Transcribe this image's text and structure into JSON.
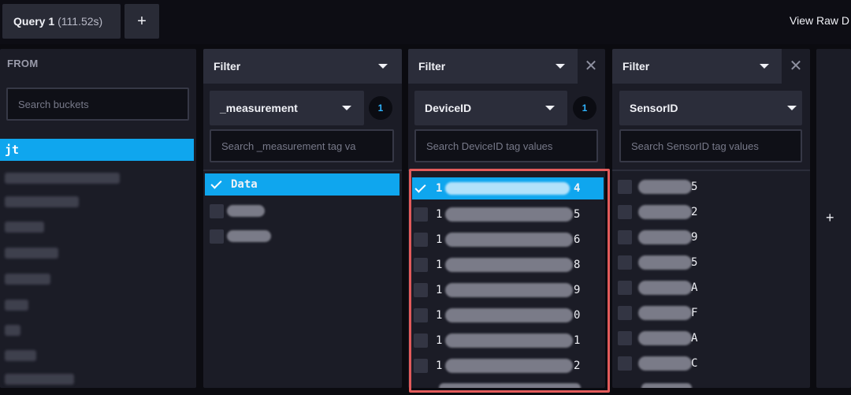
{
  "header": {
    "query_tab_label": "Query 1",
    "query_tab_time": "(111.52s)",
    "add_tab_label": "+",
    "view_raw_label": "View Raw D"
  },
  "from_panel": {
    "title": "FROM",
    "search_placeholder": "Search buckets",
    "buckets": [
      {
        "label": "jt",
        "selected": true
      },
      {
        "label": "",
        "selected": false
      },
      {
        "label": "",
        "selected": false
      },
      {
        "label": "",
        "selected": false
      },
      {
        "label": "",
        "selected": false
      },
      {
        "label": "",
        "selected": false
      },
      {
        "label": "",
        "selected": false
      },
      {
        "label": "",
        "selected": false
      },
      {
        "label": "",
        "selected": false
      },
      {
        "label": "",
        "selected": false
      }
    ]
  },
  "filter_1": {
    "header_label": "Filter",
    "tag_key": "_measurement",
    "selected_count": "1",
    "search_placeholder": "Search _measurement tag va",
    "values": [
      {
        "label": "Data",
        "checked": true
      },
      {
        "label": "",
        "checked": false
      },
      {
        "label": "",
        "checked": false
      }
    ]
  },
  "filter_2": {
    "header_label": "Filter",
    "tag_key": "DeviceID",
    "selected_count": "1",
    "search_placeholder": "Search DeviceID tag values",
    "values": [
      {
        "prefix": "1",
        "suffix": "4",
        "checked": true
      },
      {
        "prefix": "1",
        "suffix": "5",
        "checked": false
      },
      {
        "prefix": "1",
        "suffix": "6",
        "checked": false
      },
      {
        "prefix": "1",
        "suffix": "8",
        "checked": false
      },
      {
        "prefix": "1",
        "suffix": "9",
        "checked": false
      },
      {
        "prefix": "1",
        "suffix": "0",
        "checked": false
      },
      {
        "prefix": "1",
        "suffix": "1",
        "checked": false
      },
      {
        "prefix": "1",
        "suffix": "2",
        "checked": false
      }
    ],
    "highlight_color": "#e25b5b"
  },
  "filter_3": {
    "header_label": "Filter",
    "tag_key": "SensorID",
    "search_placeholder": "Search SensorID tag values",
    "values": [
      {
        "suffix": "5"
      },
      {
        "suffix": "2"
      },
      {
        "suffix": "9"
      },
      {
        "suffix": "5"
      },
      {
        "suffix": "A"
      },
      {
        "suffix": "F"
      },
      {
        "suffix": "A"
      },
      {
        "suffix": "C"
      }
    ]
  },
  "add_filter": {
    "label": "+"
  },
  "colors": {
    "accent": "#0fa6ee",
    "panel": "#1b1c26",
    "badge_text": "#2fb4ff"
  }
}
